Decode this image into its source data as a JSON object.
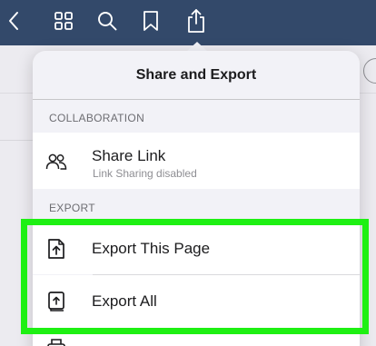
{
  "toolbar": {
    "buttons": [
      {
        "name": "back-chevron-icon"
      },
      {
        "name": "grid-icon"
      },
      {
        "name": "search-icon"
      },
      {
        "name": "bookmark-icon"
      },
      {
        "name": "share-icon"
      }
    ],
    "background": "#33496a"
  },
  "popover": {
    "title": "Share and Export",
    "sections": [
      {
        "header": "COLLABORATION",
        "items": [
          {
            "icon": "people-icon",
            "label": "Share Link",
            "sublabel": "Link Sharing disabled"
          }
        ]
      },
      {
        "header": "EXPORT",
        "items": [
          {
            "icon": "export-page-icon",
            "label": "Export This Page"
          },
          {
            "icon": "export-all-icon",
            "label": "Export All"
          }
        ]
      }
    ]
  },
  "highlight": {
    "color": "#1ef013"
  }
}
